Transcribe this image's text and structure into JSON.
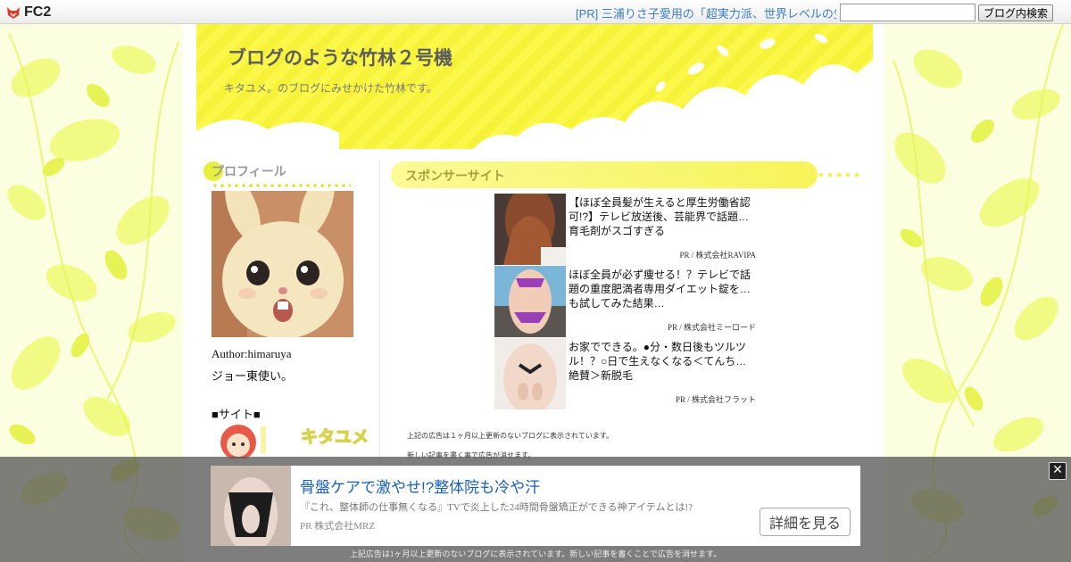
{
  "topbar": {
    "logo_text": "FC2",
    "pr_link": "[PR] 三浦りさ子愛用の「超実力派、世界レベルの生酵",
    "search_value": "",
    "search_button": "ブログ内検索"
  },
  "blog": {
    "title": "ブログのような竹林２号機",
    "subtitle": "キタユメ。のブログにみせかけた竹林です。"
  },
  "sidebar": {
    "profile_heading": "プロフィール",
    "author": "Author:himaruya",
    "author_note": "ジョー東使い。",
    "site_heading": "■サイト■",
    "site_banner_text": "キタユメ"
  },
  "sponsor": {
    "heading": "スポンサーサイト",
    "ads": [
      {
        "text": "【ほぼ全員髪が生えると厚生労働省認可!?】テレビ放送後、芸能界で話題…育毛剤がスゴすぎる",
        "sponsor": "PR / 株式会社RAVIPA"
      },
      {
        "text": "ほぼ全員が必ず痩せる！？テレビで話題の重度肥満者専用ダイエット錠を…も試してみた結果…",
        "sponsor": "PR / 株式会社ミーロード"
      },
      {
        "text": "お家でできる。●分・数日後もツルツル！？○日で生えなくなる＜てんち…絶賛＞新脱毛",
        "sponsor": "PR / 株式会社フラット"
      }
    ],
    "notice_1": "上記の広告は１ヶ月以上更新のないブログに表示されています。",
    "notice_2": "新しい記事を書く事で広告が消せます。"
  },
  "overlay_ad": {
    "close_icon": "close-icon",
    "title": "骨盤ケアで激やせ!?整体院も冷や汗",
    "description": "『これ、整体師の仕事無くなる』TVで炎上した24時間骨盤矯正ができる神アイテムとは!?",
    "sponsor": "PR  株式会社MRZ",
    "cta": "詳細を見る",
    "footer": "上記広告は1ヶ月以上更新のないブログに表示されています。新しい記事を書くことで広告を消せます。"
  },
  "colors": {
    "header_yellow": "#f8f544",
    "link_blue": "#3b7ec2",
    "overlay_title_blue": "#1a5fbf"
  }
}
